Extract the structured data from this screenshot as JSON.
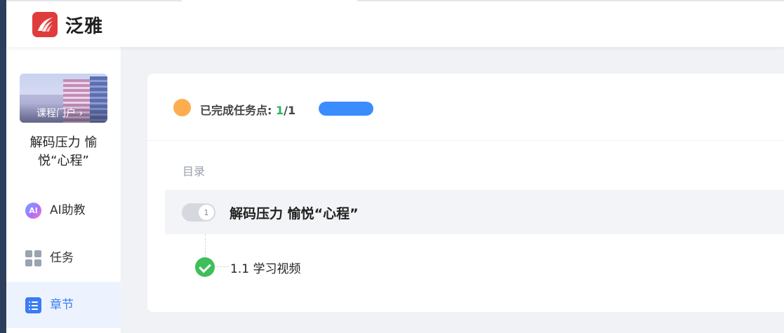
{
  "app": {
    "brand": "泛雅"
  },
  "sidebar": {
    "course_portal": "课程门户 ›",
    "course_title": "解码压力 愉悦“心程”",
    "nav": [
      {
        "label": "AI助教",
        "icon": "ai-assistant-icon",
        "active": false
      },
      {
        "label": "任务",
        "icon": "grid-icon",
        "active": false
      },
      {
        "label": "章节",
        "icon": "list-icon",
        "active": true
      }
    ]
  },
  "progress": {
    "label": "已完成任务点: ",
    "done": "1",
    "total": "/1",
    "fraction": 1.0
  },
  "toc": {
    "heading": "目录",
    "chapters": [
      {
        "number": "1",
        "title": "解码压力 愉悦“心程”",
        "sections": [
          {
            "title": "1.1 学习视频",
            "completed": true
          }
        ]
      }
    ]
  },
  "colors": {
    "accent": "#3a7cf3",
    "success": "#3fbe5b",
    "progress_dot": "#fdad4e",
    "progress_fill": "#3a8cff"
  }
}
